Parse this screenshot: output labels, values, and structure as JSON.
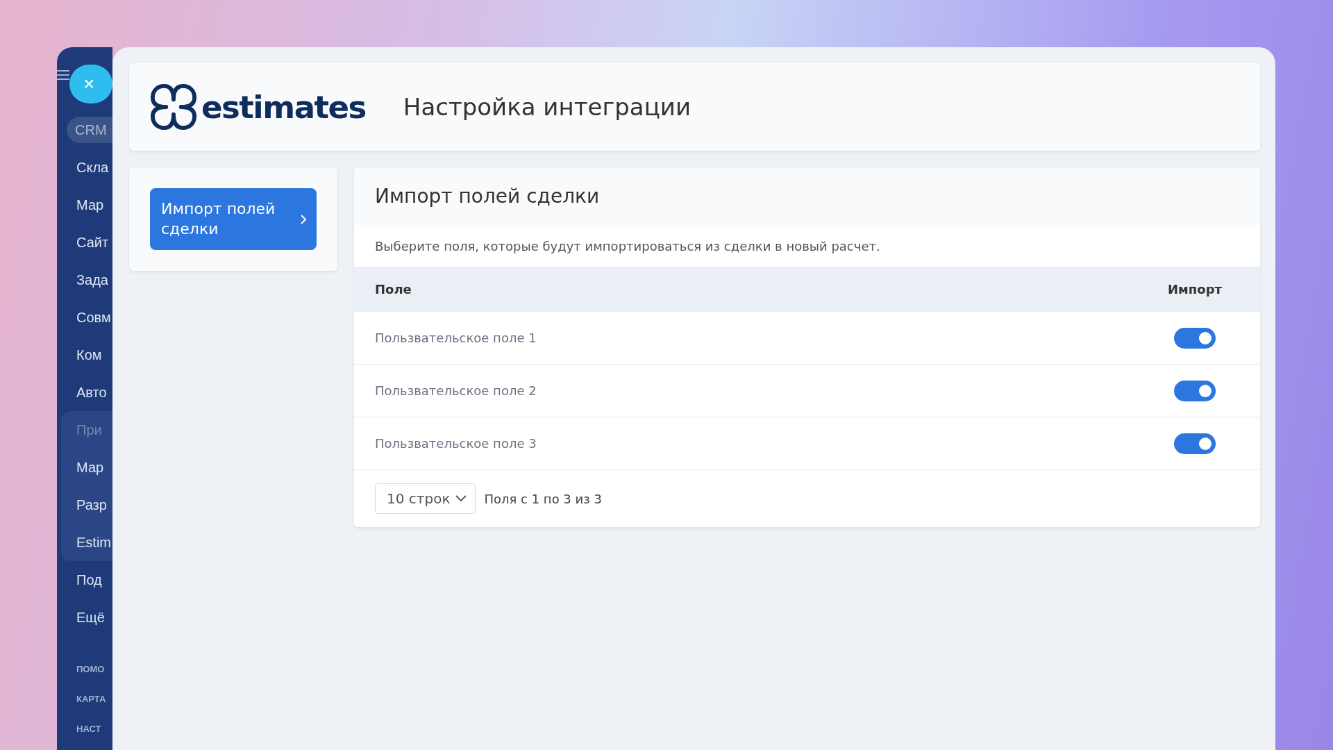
{
  "sidebar": {
    "close_button": "×",
    "items": [
      {
        "label": "CRM",
        "selected": true,
        "group": false,
        "dimmed": false
      },
      {
        "label": "Скла",
        "selected": false,
        "group": false,
        "dimmed": false
      },
      {
        "label": "Мар",
        "selected": false,
        "group": false,
        "dimmed": false
      },
      {
        "label": "Сайт",
        "selected": false,
        "group": false,
        "dimmed": false
      },
      {
        "label": "Зада",
        "selected": false,
        "group": false,
        "dimmed": false
      },
      {
        "label": "Совм",
        "selected": false,
        "group": false,
        "dimmed": false
      },
      {
        "label": "Ком",
        "selected": false,
        "group": false,
        "dimmed": false
      },
      {
        "label": "Авто",
        "selected": false,
        "group": false,
        "dimmed": false
      },
      {
        "label": "При",
        "selected": false,
        "group": true,
        "dimmed": true
      },
      {
        "label": "Мар",
        "selected": false,
        "group": true,
        "dimmed": false
      },
      {
        "label": "Разр",
        "selected": false,
        "group": true,
        "dimmed": false
      },
      {
        "label": "Estim",
        "selected": false,
        "group": true,
        "dimmed": false
      },
      {
        "label": "Под",
        "selected": false,
        "group": false,
        "dimmed": false
      },
      {
        "label": "Ещё",
        "selected": false,
        "group": false,
        "dimmed": false
      }
    ],
    "footer_links": [
      "ПОМО",
      "КАРТА",
      "НАСТ"
    ]
  },
  "header": {
    "logo_text": "estimates",
    "title": "Настройка интеграции"
  },
  "nav": [
    {
      "label": "Импорт полей сделки",
      "selected": true
    }
  ],
  "section": {
    "title": "Импорт полей сделки",
    "description": "Выберите поля, которые будут импортироваться из сделки в новый расчет.",
    "columns": [
      "Поле",
      "Импорт"
    ],
    "rows": [
      {
        "field": "Пользвательское поле 1",
        "on": true
      },
      {
        "field": "Пользвательское поле 2",
        "on": true
      },
      {
        "field": "Пользвательское поле 3",
        "on": true
      }
    ],
    "page_size": "10 строк",
    "summary": "Поля с 1 по 3 из 3"
  }
}
